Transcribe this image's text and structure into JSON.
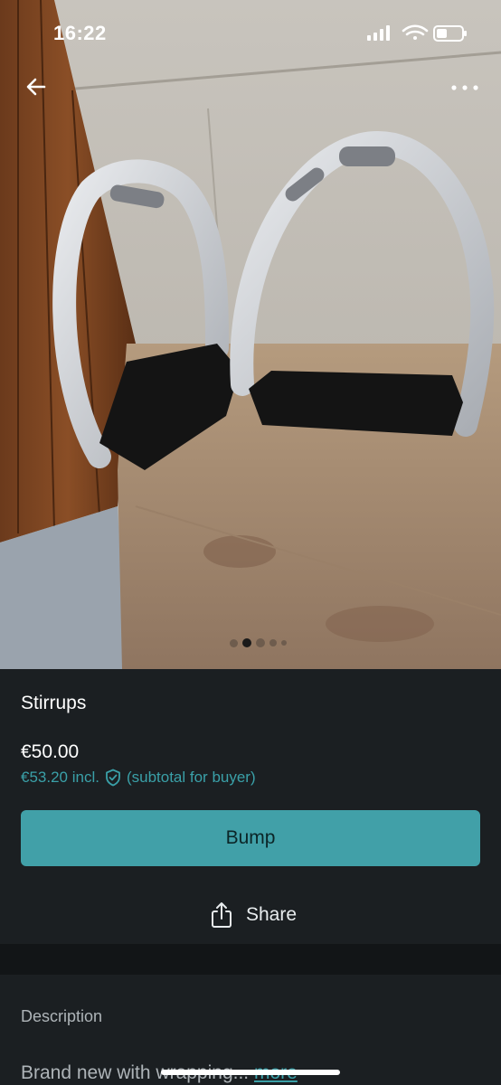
{
  "status_bar": {
    "time": "16:22"
  },
  "header": {
    "back_icon": "arrow-left-icon",
    "more_icon": "ellipsis-icon"
  },
  "gallery": {
    "total_images": 5,
    "active_index": 1
  },
  "item": {
    "title": "Stirrups",
    "price": "€50.00",
    "price_incl_amount": "€53.20 incl.",
    "price_incl_note": "(subtotal for buyer)"
  },
  "actions": {
    "bump_label": "Bump",
    "share_label": "Share"
  },
  "description": {
    "heading": "Description",
    "text": "Brand new with wrapping... ",
    "more_label": "more"
  },
  "colors": {
    "accent": "#41a0a8",
    "link": "#3aa0a8",
    "background": "#1b1f22"
  }
}
